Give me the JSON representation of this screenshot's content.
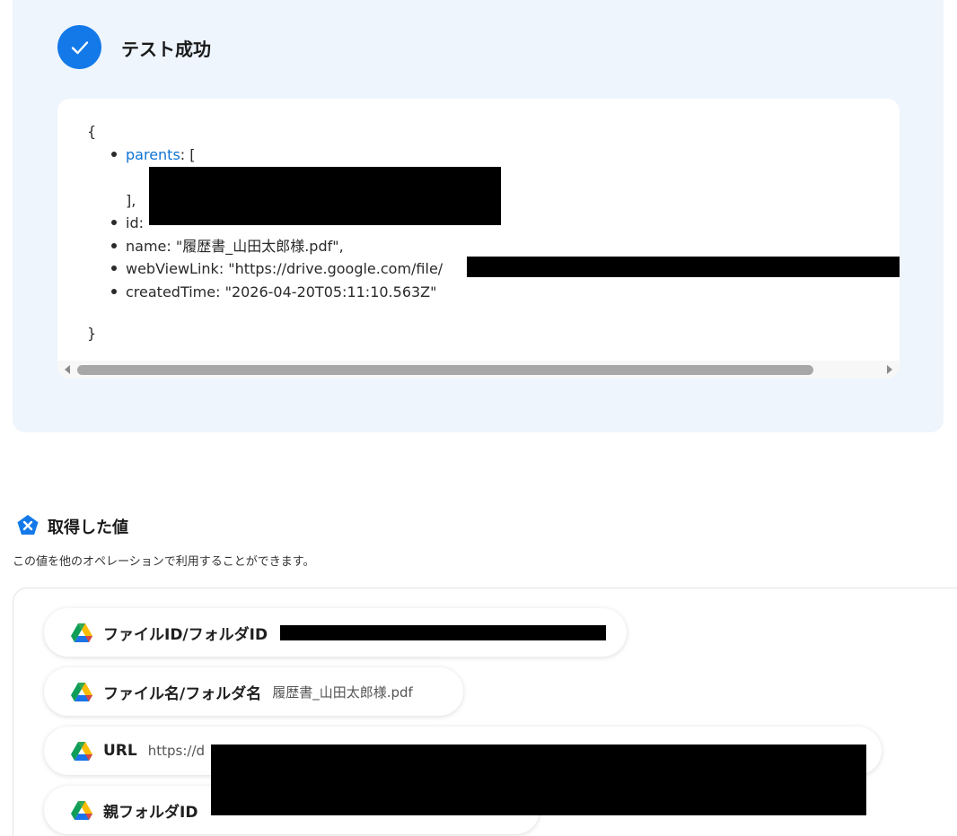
{
  "test_result": {
    "title": "テスト成功",
    "json": {
      "open_brace": "{",
      "parents_key": "parents",
      "parents_open": ": [",
      "parents_close": "],",
      "id_label": "id:",
      "name_line": "name: \"履歴書_山田太郎様.pdf\",",
      "webviewlink_line": "webViewLink: \"https://drive.google.com/file/",
      "createdtime_line": "createdTime: \"2026-04-20T05:11:10.563Z\"",
      "close_brace": "}"
    }
  },
  "obtained_values": {
    "heading": "取得した値",
    "description": "この値を他のオペレーションで利用することができます。",
    "items": [
      {
        "label": "ファイルID/フォルダID",
        "value": "",
        "icon": "google-drive-icon"
      },
      {
        "label": "ファイル名/フォルダ名",
        "value": "履歴書_山田太郎様.pdf",
        "icon": "google-drive-icon"
      },
      {
        "label": "URL",
        "value": "https://d",
        "icon": "google-drive-icon"
      },
      {
        "label": "親フォルダID",
        "value": "",
        "icon": "google-drive-icon"
      }
    ]
  },
  "colors": {
    "accent": "#1479e8",
    "panel_bg": "#eef5fd",
    "json_key": "#1173d4"
  }
}
